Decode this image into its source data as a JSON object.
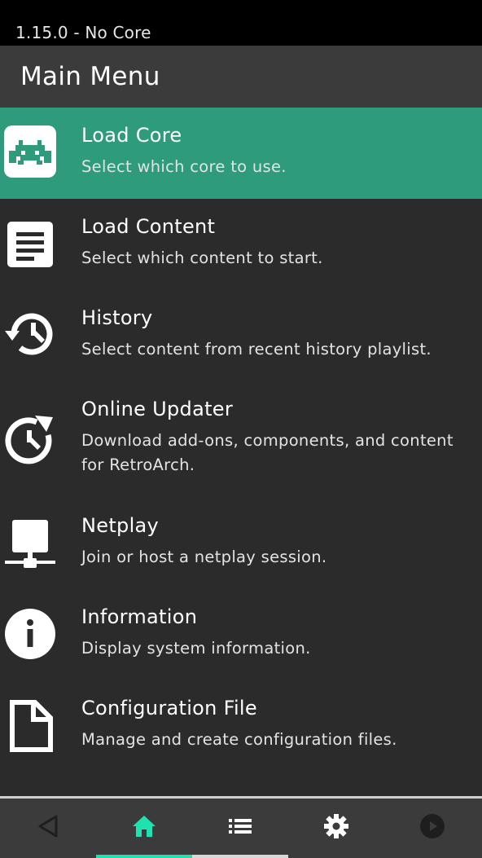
{
  "status_bar": {
    "text": "1.15.0 - No Core"
  },
  "header": {
    "title": "Main Menu"
  },
  "menu": {
    "items": [
      {
        "label": "Load Core",
        "description": "Select which core to use.",
        "icon": "retroarch-logo-icon",
        "selected": true
      },
      {
        "label": "Load Content",
        "description": "Select which content to start.",
        "icon": "document-icon",
        "selected": false
      },
      {
        "label": "History",
        "description": "Select content from recent history playlist.",
        "icon": "history-icon",
        "selected": false
      },
      {
        "label": "Online Updater",
        "description": "Download add-ons, components, and content for RetroArch.",
        "icon": "update-icon",
        "selected": false
      },
      {
        "label": "Netplay",
        "description": "Join or host a netplay session.",
        "icon": "network-icon",
        "selected": false
      },
      {
        "label": "Information",
        "description": "Display system information.",
        "icon": "info-icon",
        "selected": false
      },
      {
        "label": "Configuration File",
        "description": "Manage and create configuration files.",
        "icon": "file-icon",
        "selected": false
      }
    ]
  },
  "bottom_nav": {
    "tabs": [
      {
        "icon": "back-icon",
        "active": false
      },
      {
        "icon": "home-icon",
        "active": true
      },
      {
        "icon": "playlist-icon",
        "active": false
      },
      {
        "icon": "settings-icon",
        "active": false
      },
      {
        "icon": "play-icon",
        "active": false
      }
    ]
  },
  "colors": {
    "accent": "#2e9b7d",
    "active_tab": "#1ee3b0",
    "background": "#2b2b2b",
    "header": "#3b3b3b"
  }
}
